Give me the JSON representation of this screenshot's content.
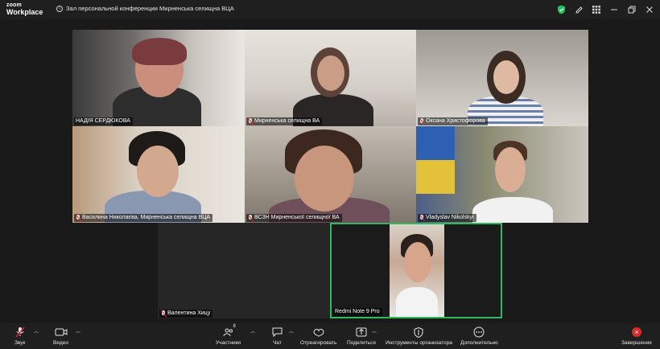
{
  "app": {
    "logo_line1": "zoom",
    "logo_line2": "Workplace",
    "meeting_title": "Зал персональной конференции Мирненська селищна ВЦА"
  },
  "participants": [
    {
      "name": "НАДІЯ СЕРДЮКОВА",
      "muted": false
    },
    {
      "name": "Мирненська селищна ВА",
      "muted": true
    },
    {
      "name": "Оксана Христофорова",
      "muted": true
    },
    {
      "name": "Василина Николаєва, Мирненська селищна ВЦА",
      "muted": true
    },
    {
      "name": "ВСЗН Мирненської селищної  ВА",
      "muted": true
    },
    {
      "name": "Vladyslav Nikolskyi",
      "muted": true
    },
    {
      "name": "Валентина Хицу",
      "muted": true
    },
    {
      "name": "Redmi Note 9 Pro",
      "muted": false,
      "active_speaker": true
    }
  ],
  "toolbar": {
    "audio": "Звук",
    "video": "Видео",
    "participants": "Участники",
    "participants_count": "8",
    "chat": "Чат",
    "react": "Отреагировать",
    "share": "Поделиться",
    "host_tools": "Инструменты организатора",
    "more": "Дополнительно",
    "end": "Завершение"
  },
  "colors": {
    "active_speaker_border": "#2fb95c",
    "end_button": "#d62b2b",
    "muted_icon": "#e02828",
    "security_shield": "#23c25c"
  }
}
